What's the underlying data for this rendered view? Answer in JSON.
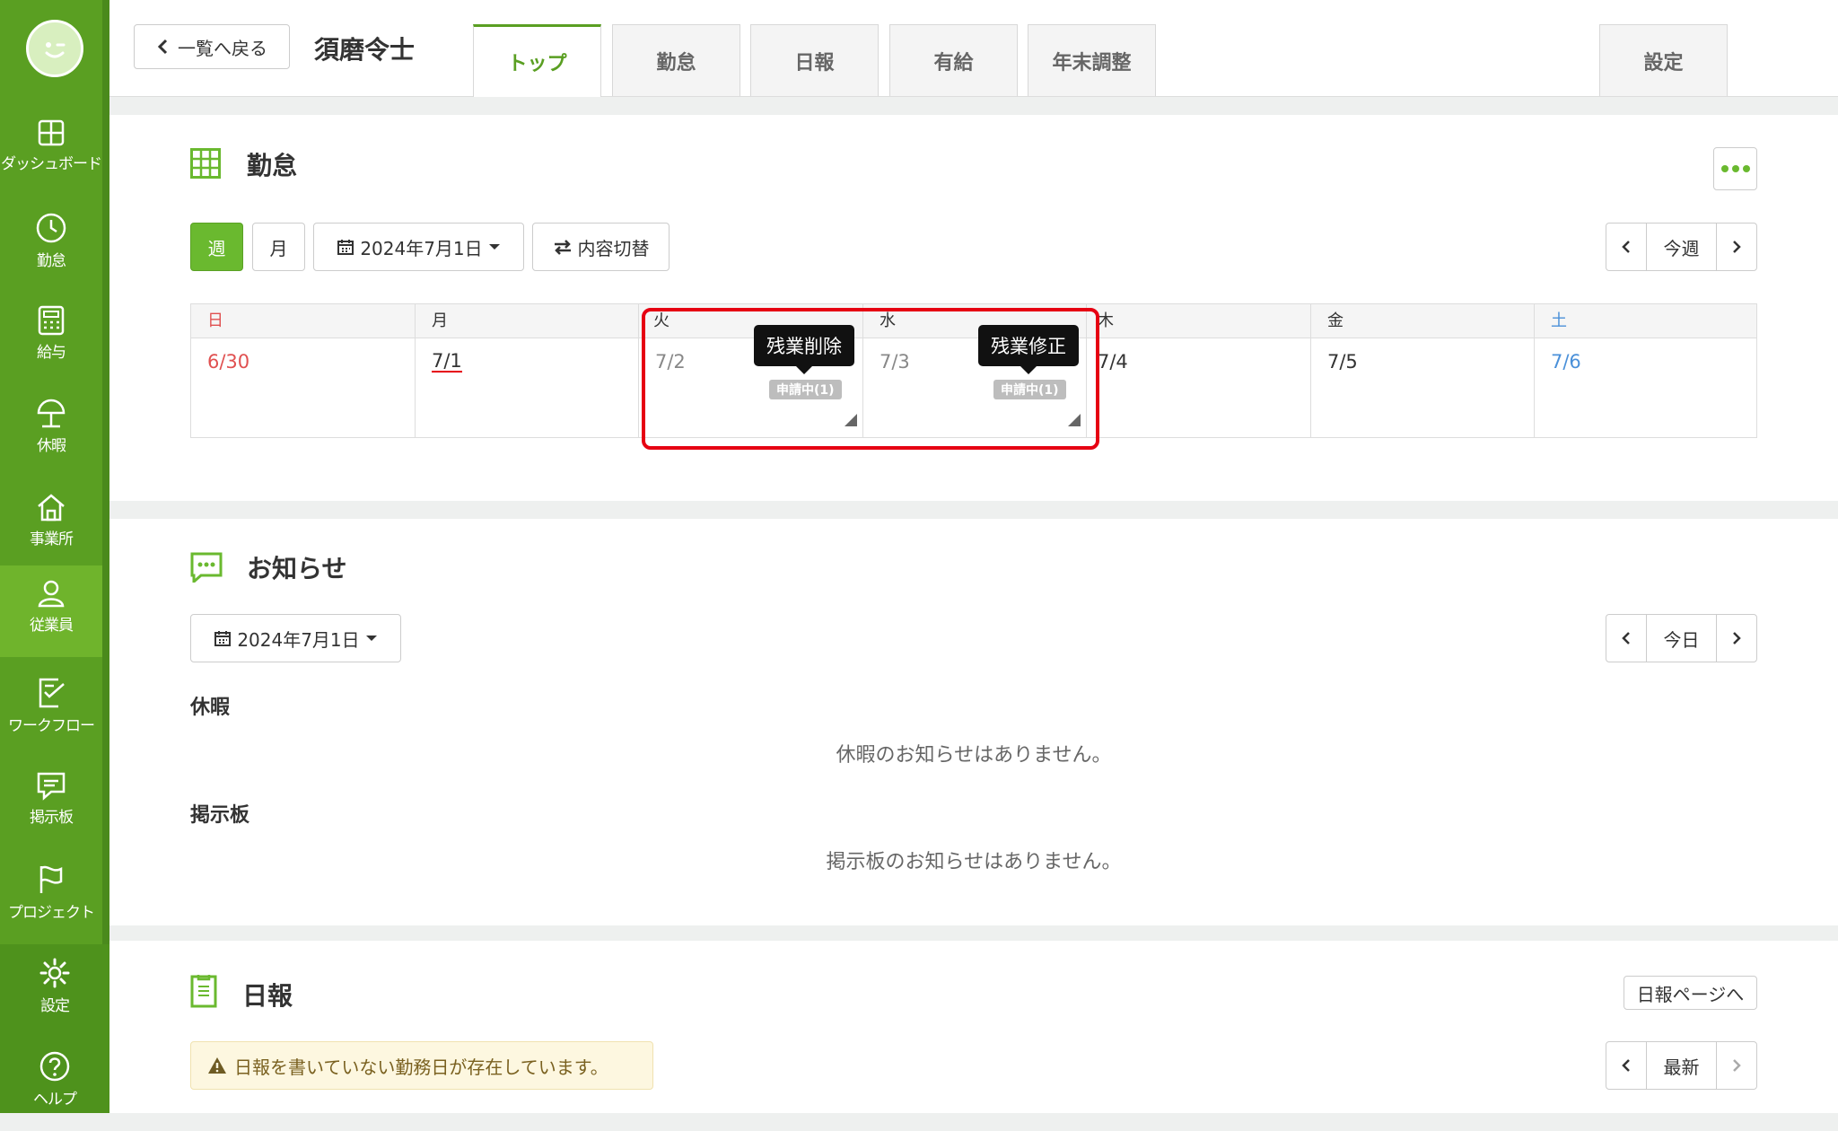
{
  "sidebar": {
    "items": [
      {
        "label": "ダッシュボード"
      },
      {
        "label": "勤怠"
      },
      {
        "label": "給与"
      },
      {
        "label": "休暇"
      },
      {
        "label": "事業所"
      },
      {
        "label": "従業員"
      },
      {
        "label": "ワークフロー"
      },
      {
        "label": "掲示板"
      },
      {
        "label": "プロジェクト"
      }
    ],
    "bottom_items": [
      {
        "label": "設定"
      },
      {
        "label": "ヘルプ"
      }
    ]
  },
  "header": {
    "back_label": "一覧へ戻る",
    "employee_name": "須磨令士",
    "tabs": [
      {
        "label": "トップ"
      },
      {
        "label": "勤怠"
      },
      {
        "label": "日報"
      },
      {
        "label": "有給"
      },
      {
        "label": "年末調整"
      }
    ],
    "settings_tab": "設定"
  },
  "attendance": {
    "title": "勤怠",
    "view_week": "週",
    "view_month": "月",
    "date_select": "2024年7月1日",
    "toggle_label": "内容切替",
    "pager": {
      "current": "今週"
    },
    "days": [
      {
        "weekday": "日",
        "date": "6/30"
      },
      {
        "weekday": "月",
        "date": "7/1"
      },
      {
        "weekday": "火",
        "date": "7/2",
        "badge": "申請中(1)",
        "tooltip": "残業削除"
      },
      {
        "weekday": "水",
        "date": "7/3",
        "badge": "申請中(1)",
        "tooltip": "残業修正"
      },
      {
        "weekday": "木",
        "date": "7/4"
      },
      {
        "weekday": "金",
        "date": "7/5"
      },
      {
        "weekday": "土",
        "date": "7/6"
      }
    ]
  },
  "news": {
    "title": "お知らせ",
    "date_select": "2024年7月1日",
    "pager": {
      "current": "今日"
    },
    "leave_heading": "休暇",
    "leave_empty": "休暇のお知らせはありません。",
    "board_heading": "掲示板",
    "board_empty": "掲示板のお知らせはありません。"
  },
  "daily_report": {
    "title": "日報",
    "page_link": "日報ページへ",
    "alert": "日報を書いていない勤務日が存在しています。",
    "pager": {
      "current": "最新"
    }
  },
  "colors": {
    "brand_green": "#5a9f22",
    "sunday_red": "#e05050",
    "saturday_blue": "#4a90d9",
    "highlight_red": "#e60012"
  }
}
